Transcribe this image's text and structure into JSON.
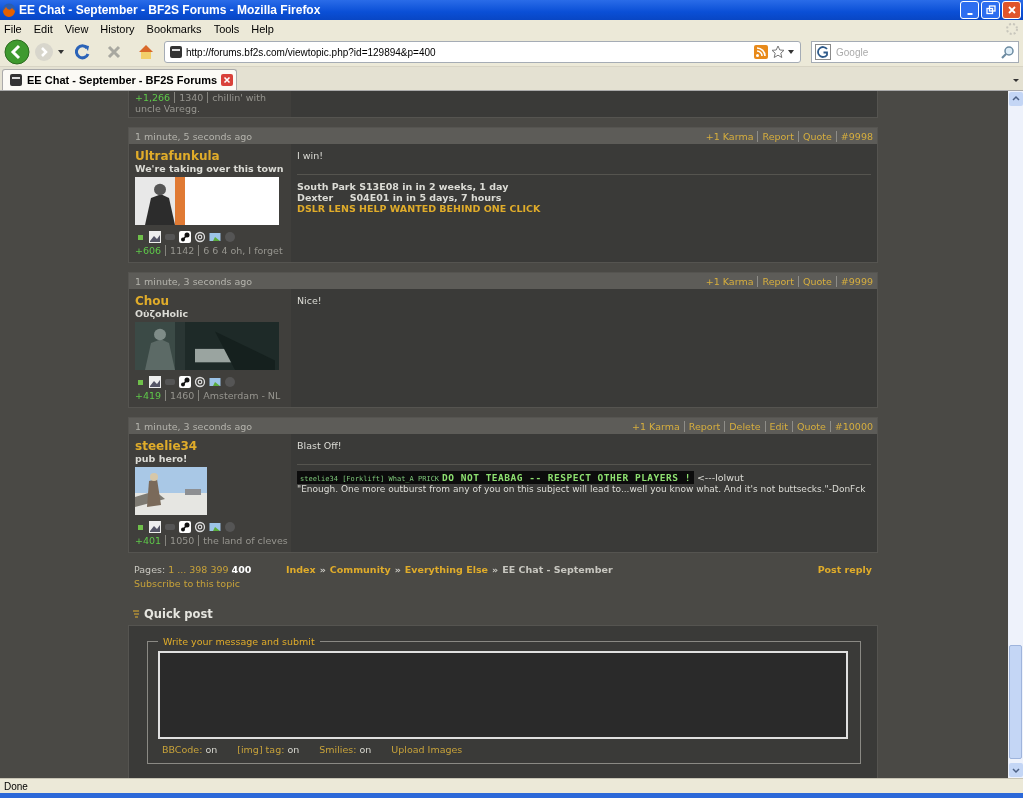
{
  "window": {
    "title": "EE Chat - September - BF2S Forums - Mozilla Firefox"
  },
  "menu": [
    "File",
    "Edit",
    "View",
    "History",
    "Bookmarks",
    "Tools",
    "Help"
  ],
  "toolbar": {
    "url": "http://forums.bf2s.com/viewtopic.php?id=129894&p=400",
    "search_placeholder": "Google"
  },
  "tabs": [
    {
      "label": "EE Chat - September - BF2S Forums",
      "selected": true
    }
  ],
  "partial_post": {
    "karma": "+1,266",
    "posts": "1340",
    "location": "chillin' with uncle Varegg."
  },
  "posts": [
    {
      "time": "1 minute, 5 seconds ago",
      "actions": [
        "+1 Karma",
        "Report",
        "Quote",
        "#9998"
      ],
      "author": "Ultrafunkula",
      "user_title": "We're taking over this town",
      "online": true,
      "karma": "+606",
      "posts": "1142",
      "location": "6 6 4 oh, I forget",
      "message": "I win!",
      "signature": [
        {
          "kind": "text",
          "text": "South Park S13E08 in in 2 weeks, 1 day"
        },
        {
          "kind": "text",
          "text": "Dexter     S04E01 in in 5 days, 7 hours"
        },
        {
          "kind": "link",
          "text": "DSLR LENS HELP WANTED BEHIND ONE CLICK"
        }
      ]
    },
    {
      "time": "1 minute, 3 seconds ago",
      "actions": [
        "+1 Karma",
        "Report",
        "Quote",
        "#9999"
      ],
      "author": "Chou",
      "user_title": "OὐζoHolic",
      "online": true,
      "karma": "+419",
      "posts": "1460",
      "location": "Amsterdam - NL",
      "message": "Nice!"
    },
    {
      "time": "1 minute, 3 seconds ago",
      "actions": [
        "+1 Karma",
        "Report",
        "Delete",
        "Edit",
        "Quote",
        "#10000"
      ],
      "author": "steelie34",
      "user_title": "pub hero!",
      "online": true,
      "karma": "+401",
      "posts": "1050",
      "location": "the land of cleves",
      "message": "Blast Off!",
      "signature": [
        {
          "kind": "banner",
          "small": "steelie34 [Forklift] What_A PRICK",
          "big": "DO NOT TEABAG -- RESPECT OTHER PLAYERS !",
          "after": "<---lolwut"
        },
        {
          "kind": "text",
          "text": "\"Enough. One more outburst from any of you on this subject will lead to...well you know what. And it's not buttsecks.\"-DonFck"
        }
      ]
    }
  ],
  "pagination": {
    "label": "Pages:",
    "pages": [
      {
        "label": "1",
        "current": false
      },
      {
        "label": "...",
        "current": false
      },
      {
        "label": "398",
        "current": false
      },
      {
        "label": "399",
        "current": false
      },
      {
        "label": "400",
        "current": true
      }
    ],
    "subscribe": "Subscribe to this topic"
  },
  "breadcrumbs": [
    {
      "label": "Index",
      "link": true
    },
    {
      "label": "Community",
      "link": true
    },
    {
      "label": "Everything Else",
      "link": true
    },
    {
      "label": "EE Chat - September",
      "link": false
    }
  ],
  "breadcrumb_separator": "»",
  "post_reply": "Post reply",
  "quick_post": {
    "heading": "Quick post",
    "legend": "Write your message and submit",
    "options": [
      {
        "label": "BBCode:",
        "value": "on"
      },
      {
        "label": "[img] tag:",
        "value": "on"
      },
      {
        "label": "Smilies:",
        "value": "on"
      }
    ],
    "upload": "Upload Images"
  },
  "status_bar": "Done"
}
